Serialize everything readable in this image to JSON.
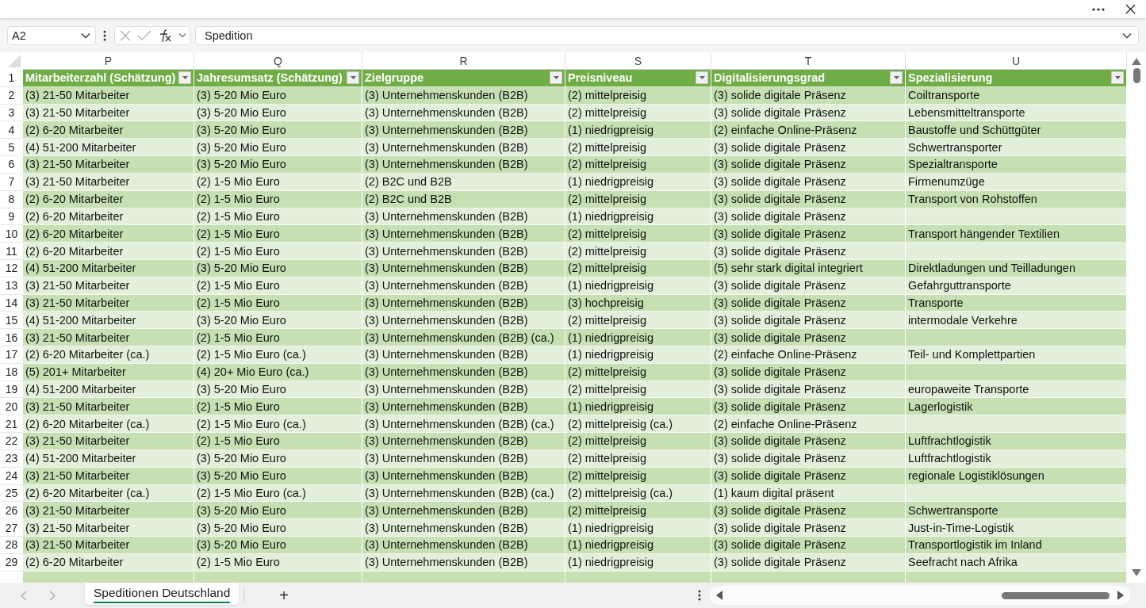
{
  "formula_bar": {
    "name_box": "A2",
    "formula": "Spedition"
  },
  "column_letters": [
    "P",
    "Q",
    "R",
    "S",
    "T",
    "U"
  ],
  "header_row": {
    "number": "1",
    "cells": [
      "Mitarbeiterzahl (Schätzung)",
      "Jahresumsatz (Schätzung)",
      "Zielgruppe",
      "Preisniveau",
      "Digitalisierungsgrad",
      "Spezialisierung"
    ]
  },
  "rows": [
    {
      "number": "2",
      "cells": [
        "(3) 21-50 Mitarbeiter",
        "(3) 5-20 Mio Euro",
        "(3) Unternehmenskunden (B2B)",
        "(2) mittelpreisig",
        "(3) solide digitale Präsenz",
        "Coiltransporte"
      ]
    },
    {
      "number": "3",
      "cells": [
        "(3) 21-50 Mitarbeiter",
        "(3) 5-20 Mio Euro",
        "(3) Unternehmenskunden (B2B)",
        "(2) mittelpreisig",
        "(3) solide digitale Präsenz",
        "Lebensmitteltransporte"
      ]
    },
    {
      "number": "4",
      "cells": [
        "(2) 6-20 Mitarbeiter",
        "(3) 5-20 Mio Euro",
        "(3) Unternehmenskunden (B2B)",
        "(1) niedrigpreisig",
        "(2) einfache Online-Präsenz",
        "Baustoffe und Schüttgüter"
      ]
    },
    {
      "number": "5",
      "cells": [
        "(4) 51-200 Mitarbeiter",
        "(3) 5-20 Mio Euro",
        "(3) Unternehmenskunden (B2B)",
        "(2) mittelpreisig",
        "(3) solide digitale Präsenz",
        "Schwertransporter"
      ]
    },
    {
      "number": "6",
      "cells": [
        "(3) 21-50 Mitarbeiter",
        "(3) 5-20 Mio Euro",
        "(3) Unternehmenskunden (B2B)",
        "(2) mittelpreisig",
        "(3) solide digitale Präsenz",
        "Spezialtransporte"
      ]
    },
    {
      "number": "7",
      "cells": [
        "(3) 21-50 Mitarbeiter",
        "(2) 1-5 Mio Euro",
        "(2) B2C und B2B",
        "(1) niedrigpreisig",
        "(3) solide digitale Präsenz",
        "Firmenumzüge"
      ]
    },
    {
      "number": "8",
      "cells": [
        "(2) 6-20 Mitarbeiter",
        "(2) 1-5 Mio Euro",
        "(2) B2C und B2B",
        "(2) mittelpreisig",
        "(3) solide digitale Präsenz",
        "Transport von Rohstoffen"
      ]
    },
    {
      "number": "9",
      "cells": [
        "(2) 6-20 Mitarbeiter",
        "(2) 1-5 Mio Euro",
        "(3) Unternehmenskunden (B2B)",
        "(1) niedrigpreisig",
        "(3) solide digitale Präsenz"
      ]
    },
    {
      "number": "10",
      "cells": [
        "(2) 6-20 Mitarbeiter",
        "(2) 1-5 Mio Euro",
        "(3) Unternehmenskunden (B2B)",
        "(2) mittelpreisig",
        "(3) solide digitale Präsenz",
        "Transport hängender Textilien"
      ]
    },
    {
      "number": "11",
      "cells": [
        "(2) 6-20 Mitarbeiter",
        "(2) 1-5 Mio Euro",
        "(3) Unternehmenskunden (B2B)",
        "(2) mittelpreisig",
        "(3) solide digitale Präsenz"
      ]
    },
    {
      "number": "12",
      "cells": [
        "(4) 51-200 Mitarbeiter",
        "(3) 5-20 Mio Euro",
        "(3) Unternehmenskunden (B2B)",
        "(2) mittelpreisig",
        "(5) sehr stark digital integriert",
        "Direktladungen und Teilladungen"
      ]
    },
    {
      "number": "13",
      "cells": [
        "(3) 21-50 Mitarbeiter",
        "(2) 1-5 Mio Euro",
        "(3) Unternehmenskunden (B2B)",
        "(1) niedrigpreisig",
        "(3) solide digitale Präsenz",
        "Gefahrguttransporte"
      ]
    },
    {
      "number": "14",
      "cells": [
        "(3) 21-50 Mitarbeiter",
        "(2) 1-5 Mio Euro",
        "(3) Unternehmenskunden (B2B)",
        "(3) hochpreisig",
        "(3) solide digitale Präsenz",
        "Transporte"
      ]
    },
    {
      "number": "15",
      "cells": [
        "(4) 51-200 Mitarbeiter",
        "(3) 5-20 Mio Euro",
        "(3) Unternehmenskunden (B2B)",
        "(2) mittelpreisig",
        "(3) solide digitale Präsenz",
        "intermodale Verkehre"
      ]
    },
    {
      "number": "16",
      "cells": [
        "(3) 21-50 Mitarbeiter",
        "(2) 1-5 Mio Euro",
        "(3) Unternehmenskunden (B2B) (ca.)",
        "(1) niedrigpreisig",
        "(3) solide digitale Präsenz"
      ]
    },
    {
      "number": "17",
      "cells": [
        "(2) 6-20 Mitarbeiter (ca.)",
        "(2) 1-5 Mio Euro (ca.)",
        "(3) Unternehmenskunden (B2B)",
        "(1) niedrigpreisig",
        "(2) einfache Online-Präsenz",
        "Teil- und Komplettpartien"
      ]
    },
    {
      "number": "18",
      "cells": [
        "(5) 201+ Mitarbeiter",
        "(4) 20+ Mio Euro (ca.)",
        "(3) Unternehmenskunden (B2B)",
        "(2) mittelpreisig",
        "(3) solide digitale Präsenz"
      ]
    },
    {
      "number": "19",
      "cells": [
        "(4) 51-200 Mitarbeiter",
        "(3) 5-20 Mio Euro",
        "(3) Unternehmenskunden (B2B)",
        "(2) mittelpreisig",
        "(3) solide digitale Präsenz",
        "europaweite Transporte"
      ]
    },
    {
      "number": "20",
      "cells": [
        "(3) 21-50 Mitarbeiter",
        "(2) 1-5 Mio Euro",
        "(3) Unternehmenskunden (B2B)",
        "(1) niedrigpreisig",
        "(3) solide digitale Präsenz",
        "Lagerlogistik"
      ]
    },
    {
      "number": "21",
      "cells": [
        "(2) 6-20 Mitarbeiter (ca.)",
        "(2) 1-5 Mio Euro (ca.)",
        "(3) Unternehmenskunden (B2B) (ca.)",
        "(2) mittelpreisig (ca.)",
        "(2) einfache Online-Präsenz"
      ]
    },
    {
      "number": "22",
      "cells": [
        "(3) 21-50 Mitarbeiter",
        "(2) 1-5 Mio Euro",
        "(3) Unternehmenskunden (B2B)",
        "(2) mittelpreisig",
        "(3) solide digitale Präsenz",
        "Luftfrachtlogistik"
      ]
    },
    {
      "number": "23",
      "cells": [
        "(4) 51-200 Mitarbeiter",
        "(3) 5-20 Mio Euro",
        "(3) Unternehmenskunden (B2B)",
        "(2) mittelpreisig",
        "(3) solide digitale Präsenz",
        "Luftfrachtlogistik"
      ]
    },
    {
      "number": "24",
      "cells": [
        "(3) 21-50 Mitarbeiter",
        "(3) 5-20 Mio Euro",
        "(3) Unternehmenskunden (B2B)",
        "(2) mittelpreisig",
        "(3) solide digitale Präsenz",
        "regionale Logistiklösungen"
      ]
    },
    {
      "number": "25",
      "cells": [
        "(2) 6-20 Mitarbeiter (ca.)",
        "(2) 1-5 Mio Euro (ca.)",
        "(3) Unternehmenskunden (B2B) (ca.)",
        "(2) mittelpreisig (ca.)",
        "(1) kaum digital präsent"
      ]
    },
    {
      "number": "26",
      "cells": [
        "(3) 21-50 Mitarbeiter",
        "(3) 5-20 Mio Euro",
        "(3) Unternehmenskunden (B2B)",
        "(2) mittelpreisig",
        "(3) solide digitale Präsenz",
        "Schwertransporte"
      ]
    },
    {
      "number": "27",
      "cells": [
        "(3) 21-50 Mitarbeiter",
        "(3) 5-20 Mio Euro",
        "(3) Unternehmenskunden (B2B)",
        "(1) niedrigpreisig",
        "(3) solide digitale Präsenz",
        "Just-in-Time-Logistik"
      ]
    },
    {
      "number": "28",
      "cells": [
        "(3) 21-50 Mitarbeiter",
        "(3) 5-20 Mio Euro",
        "(3) Unternehmenskunden (B2B)",
        "(1) niedrigpreisig",
        "(3) solide digitale Präsenz",
        "Transportlogistik im Inland"
      ]
    },
    {
      "number": "29",
      "cells": [
        "(2) 6-20 Mitarbeiter",
        "(2) 1-5 Mio Euro",
        "(3) Unternehmenskunden (B2B)",
        "(1) niedrigpreisig",
        "(3) solide digitale Präsenz",
        "Seefracht nach Afrika"
      ]
    }
  ],
  "sheet_tabs": [
    {
      "label": "Speditionen Deutschland",
      "selected": true
    }
  ],
  "add_sheet": "+"
}
